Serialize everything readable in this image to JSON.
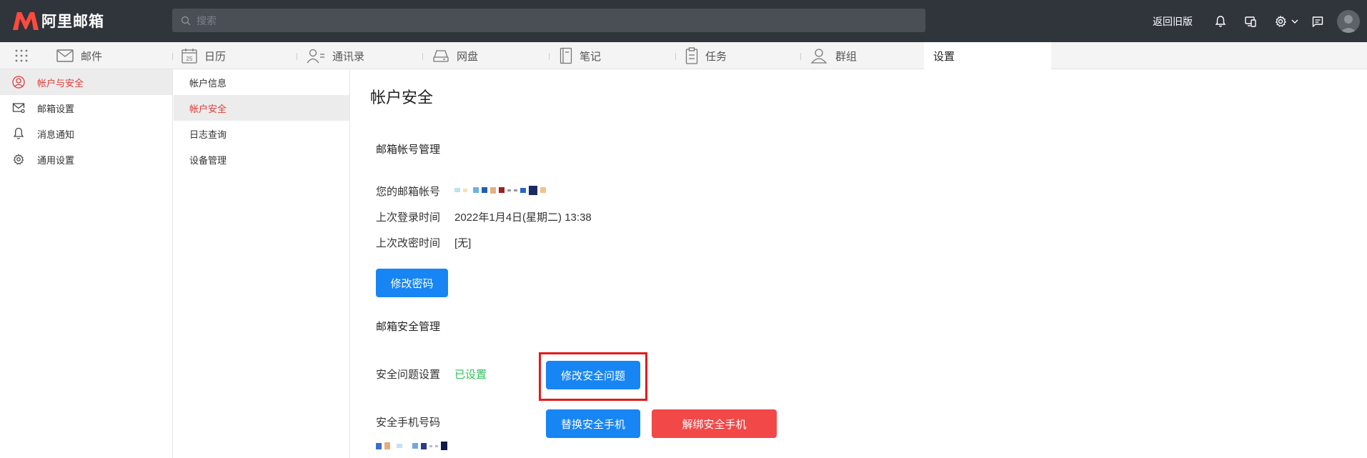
{
  "header": {
    "logo_text": "阿里邮箱",
    "search_placeholder": "搜索",
    "back_old": "返回旧版",
    "icons": [
      "bell-icon",
      "devices-icon",
      "gear-icon",
      "chevron-down-icon",
      "message-icon",
      "avatar"
    ]
  },
  "nav": {
    "tabs": [
      {
        "label": "邮件",
        "icon": "mail-icon"
      },
      {
        "label": "日历",
        "icon": "calendar-icon",
        "badge": "25"
      },
      {
        "label": "通讯录",
        "icon": "contacts-icon"
      },
      {
        "label": "网盘",
        "icon": "drive-icon"
      },
      {
        "label": "笔记",
        "icon": "note-icon"
      },
      {
        "label": "任务",
        "icon": "task-icon"
      },
      {
        "label": "群组",
        "icon": "group-icon"
      },
      {
        "label": "设置",
        "icon": ""
      }
    ]
  },
  "sidebar": {
    "items": [
      {
        "label": "帐户与安全",
        "icon": "user-circle-icon",
        "active": true
      },
      {
        "label": "邮箱设置",
        "icon": "mail-gear-icon"
      },
      {
        "label": "消息通知",
        "icon": "bell-icon"
      },
      {
        "label": "通用设置",
        "icon": "gear-icon"
      }
    ]
  },
  "subsidebar": {
    "items": [
      {
        "label": "帐户信息"
      },
      {
        "label": "帐户安全",
        "active": true
      },
      {
        "label": "日志查询"
      },
      {
        "label": "设备管理"
      }
    ]
  },
  "main": {
    "title": "帐户安全",
    "account_section": "邮箱帐号管理",
    "account_label": "您的邮箱帐号",
    "last_login_label": "上次登录时间",
    "last_login_value": "2022年1月4日(星期二) 13:38",
    "last_pwd_label": "上次改密时间",
    "last_pwd_value": "[无]",
    "change_pwd_button": "修改密码",
    "security_section": "邮箱安全管理",
    "security_q_label": "安全问题设置",
    "security_q_status": "已设置",
    "change_q_button": "修改安全问题",
    "phone_label": "安全手机号码",
    "replace_phone_button": "替换安全手机",
    "unbind_phone_button": "解绑安全手机"
  },
  "colors": {
    "header_bg": "#30343b",
    "accent_red": "#e03a3a",
    "button_blue": "#1785f3",
    "button_red": "#f24848",
    "status_green": "#2ec25a",
    "highlight_red": "#e21c1c"
  }
}
